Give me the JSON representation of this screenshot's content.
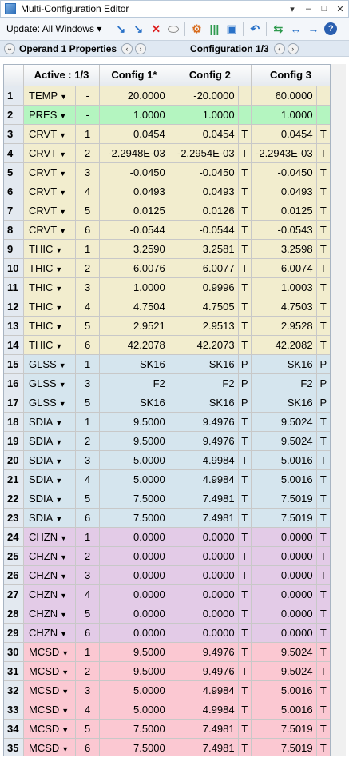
{
  "window": {
    "title": "Multi-Configuration Editor",
    "controls": [
      "▾",
      "–",
      "□",
      "✕"
    ]
  },
  "toolbar": {
    "update_label": "Update: All Windows ▾"
  },
  "props": {
    "operand_label": "Operand 1 Properties",
    "config_label": "Configuration 1/3"
  },
  "table": {
    "headers": [
      "",
      "Active : 1/3",
      "",
      "Config 1*",
      "",
      "Config 2",
      "",
      "Config 3",
      ""
    ],
    "groups": {
      "yellow": "#f2edce",
      "green": "#b4f5c0",
      "blue": "#d5e5ee",
      "purple": "#e3cbe7",
      "red": "#fbc8d2"
    },
    "rows": [
      [
        "1",
        "TEMP",
        "-",
        "20.0000",
        "",
        "-20.0000",
        "",
        "60.0000",
        "",
        "yellow"
      ],
      [
        "2",
        "PRES",
        "-",
        "1.0000",
        "",
        "1.0000",
        "",
        "1.0000",
        "",
        "green"
      ],
      [
        "3",
        "CRVT",
        "1",
        "0.0454",
        "",
        "0.0454",
        "T",
        "0.0454",
        "T",
        "yellow"
      ],
      [
        "4",
        "CRVT",
        "2",
        "-2.2948E-03",
        "",
        "-2.2954E-03",
        "T",
        "-2.2943E-03",
        "T",
        "yellow"
      ],
      [
        "5",
        "CRVT",
        "3",
        "-0.0450",
        "",
        "-0.0450",
        "T",
        "-0.0450",
        "T",
        "yellow"
      ],
      [
        "6",
        "CRVT",
        "4",
        "0.0493",
        "",
        "0.0493",
        "T",
        "0.0493",
        "T",
        "yellow"
      ],
      [
        "7",
        "CRVT",
        "5",
        "0.0125",
        "",
        "0.0126",
        "T",
        "0.0125",
        "T",
        "yellow"
      ],
      [
        "8",
        "CRVT",
        "6",
        "-0.0544",
        "",
        "-0.0544",
        "T",
        "-0.0543",
        "T",
        "yellow"
      ],
      [
        "9",
        "THIC",
        "1",
        "3.2590",
        "",
        "3.2581",
        "T",
        "3.2598",
        "T",
        "yellow"
      ],
      [
        "10",
        "THIC",
        "2",
        "6.0076",
        "",
        "6.0077",
        "T",
        "6.0074",
        "T",
        "yellow"
      ],
      [
        "11",
        "THIC",
        "3",
        "1.0000",
        "",
        "0.9996",
        "T",
        "1.0003",
        "T",
        "yellow"
      ],
      [
        "12",
        "THIC",
        "4",
        "4.7504",
        "",
        "4.7505",
        "T",
        "4.7503",
        "T",
        "yellow"
      ],
      [
        "13",
        "THIC",
        "5",
        "2.9521",
        "",
        "2.9513",
        "T",
        "2.9528",
        "T",
        "yellow"
      ],
      [
        "14",
        "THIC",
        "6",
        "42.2078",
        "",
        "42.2073",
        "T",
        "42.2082",
        "T",
        "yellow"
      ],
      [
        "15",
        "GLSS",
        "1",
        "SK16",
        "",
        "SK16",
        "P",
        "SK16",
        "P",
        "blue"
      ],
      [
        "16",
        "GLSS",
        "3",
        "F2",
        "",
        "F2",
        "P",
        "F2",
        "P",
        "blue"
      ],
      [
        "17",
        "GLSS",
        "5",
        "SK16",
        "",
        "SK16",
        "P",
        "SK16",
        "P",
        "blue"
      ],
      [
        "18",
        "SDIA",
        "1",
        "9.5000",
        "",
        "9.4976",
        "T",
        "9.5024",
        "T",
        "blue"
      ],
      [
        "19",
        "SDIA",
        "2",
        "9.5000",
        "",
        "9.4976",
        "T",
        "9.5024",
        "T",
        "blue"
      ],
      [
        "20",
        "SDIA",
        "3",
        "5.0000",
        "",
        "4.9984",
        "T",
        "5.0016",
        "T",
        "blue"
      ],
      [
        "21",
        "SDIA",
        "4",
        "5.0000",
        "",
        "4.9984",
        "T",
        "5.0016",
        "T",
        "blue"
      ],
      [
        "22",
        "SDIA",
        "5",
        "7.5000",
        "",
        "7.4981",
        "T",
        "7.5019",
        "T",
        "blue"
      ],
      [
        "23",
        "SDIA",
        "6",
        "7.5000",
        "",
        "7.4981",
        "T",
        "7.5019",
        "T",
        "blue"
      ],
      [
        "24",
        "CHZN",
        "1",
        "0.0000",
        "",
        "0.0000",
        "T",
        "0.0000",
        "T",
        "purple"
      ],
      [
        "25",
        "CHZN",
        "2",
        "0.0000",
        "",
        "0.0000",
        "T",
        "0.0000",
        "T",
        "purple"
      ],
      [
        "26",
        "CHZN",
        "3",
        "0.0000",
        "",
        "0.0000",
        "T",
        "0.0000",
        "T",
        "purple"
      ],
      [
        "27",
        "CHZN",
        "4",
        "0.0000",
        "",
        "0.0000",
        "T",
        "0.0000",
        "T",
        "purple"
      ],
      [
        "28",
        "CHZN",
        "5",
        "0.0000",
        "",
        "0.0000",
        "T",
        "0.0000",
        "T",
        "purple"
      ],
      [
        "29",
        "CHZN",
        "6",
        "0.0000",
        "",
        "0.0000",
        "T",
        "0.0000",
        "T",
        "purple"
      ],
      [
        "30",
        "MCSD",
        "1",
        "9.5000",
        "",
        "9.4976",
        "T",
        "9.5024",
        "T",
        "red"
      ],
      [
        "31",
        "MCSD",
        "2",
        "9.5000",
        "",
        "9.4976",
        "T",
        "9.5024",
        "T",
        "red"
      ],
      [
        "32",
        "MCSD",
        "3",
        "5.0000",
        "",
        "4.9984",
        "T",
        "5.0016",
        "T",
        "red"
      ],
      [
        "33",
        "MCSD",
        "4",
        "5.0000",
        "",
        "4.9984",
        "T",
        "5.0016",
        "T",
        "red"
      ],
      [
        "34",
        "MCSD",
        "5",
        "7.5000",
        "",
        "7.4981",
        "T",
        "7.5019",
        "T",
        "red"
      ],
      [
        "35",
        "MCSD",
        "6",
        "7.5000",
        "",
        "7.4981",
        "T",
        "7.5019",
        "T",
        "red"
      ]
    ]
  }
}
